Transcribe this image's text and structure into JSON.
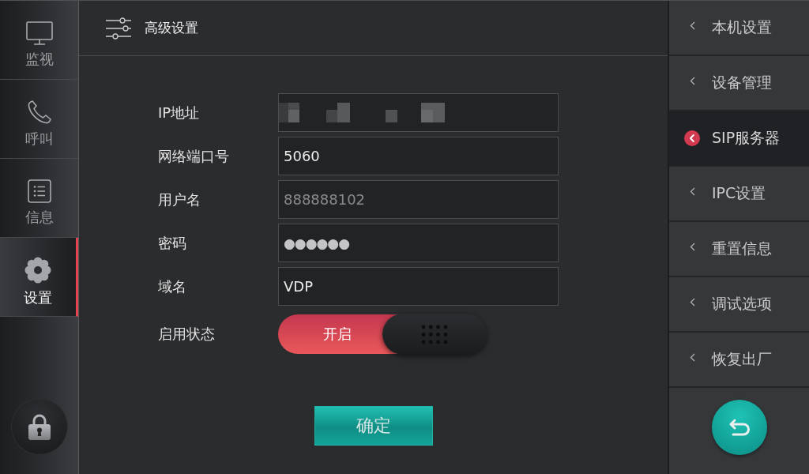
{
  "sidebar": {
    "items": [
      {
        "label": "监视",
        "selected": false
      },
      {
        "label": "呼叫",
        "selected": false
      },
      {
        "label": "信息",
        "selected": false
      },
      {
        "label": "设置",
        "selected": true
      }
    ]
  },
  "header": {
    "title": "高级设置"
  },
  "form": {
    "fields": [
      {
        "kind": "text",
        "label": "IP地址",
        "obscured": true
      },
      {
        "kind": "text",
        "label": "网络端口号",
        "value": "5060"
      },
      {
        "kind": "text",
        "label": "用户名",
        "placeholder": "888888102"
      },
      {
        "kind": "password",
        "label": "密码",
        "value": "●●●●●●"
      },
      {
        "kind": "text",
        "label": "域名",
        "value": "VDP"
      },
      {
        "kind": "switch",
        "label": "启用状态",
        "on": true,
        "state_label": "开启"
      }
    ],
    "confirm_button": "确定"
  },
  "settings_menu": {
    "items": [
      {
        "label": "本机设置",
        "selected": false
      },
      {
        "label": "设备管理",
        "selected": false
      },
      {
        "label": "SIP服务器",
        "selected": true
      },
      {
        "label": "IPC设置",
        "selected": false
      },
      {
        "label": "重置信息",
        "selected": false
      },
      {
        "label": "调试选项",
        "selected": false
      },
      {
        "label": "恢复出厂",
        "selected": false
      }
    ]
  }
}
